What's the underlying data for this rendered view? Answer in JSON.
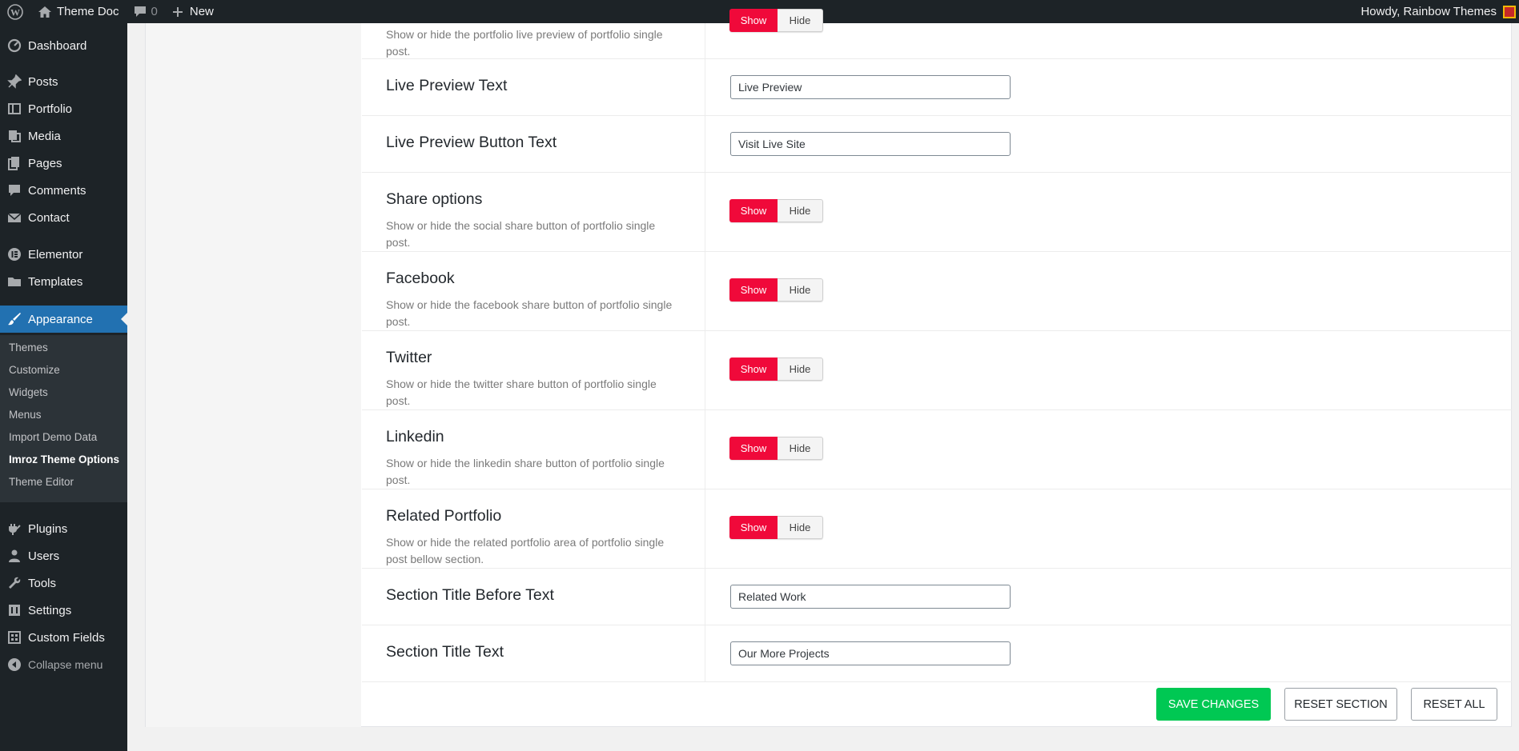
{
  "adminbar": {
    "site_name": "Theme Doc",
    "comments_count": "0",
    "new_label": "New",
    "greeting": "Howdy, Rainbow Themes"
  },
  "sidebar": {
    "items": [
      {
        "label": "Dashboard",
        "icon": "dashboard-icon"
      },
      {
        "label": "Posts",
        "icon": "pin-icon"
      },
      {
        "label": "Portfolio",
        "icon": "portfolio-icon"
      },
      {
        "label": "Media",
        "icon": "media-icon"
      },
      {
        "label": "Pages",
        "icon": "pages-icon"
      },
      {
        "label": "Comments",
        "icon": "comment-icon"
      },
      {
        "label": "Contact",
        "icon": "mail-icon"
      },
      {
        "label": "Elementor",
        "icon": "elementor-icon"
      },
      {
        "label": "Templates",
        "icon": "folder-icon"
      },
      {
        "label": "Appearance",
        "icon": "brush-icon"
      },
      {
        "label": "Plugins",
        "icon": "plug-icon"
      },
      {
        "label": "Users",
        "icon": "user-icon"
      },
      {
        "label": "Tools",
        "icon": "wrench-icon"
      },
      {
        "label": "Settings",
        "icon": "settings-icon"
      },
      {
        "label": "Custom Fields",
        "icon": "grid-icon"
      }
    ],
    "submenu": [
      "Themes",
      "Customize",
      "Widgets",
      "Menus",
      "Import Demo Data",
      "Imroz Theme Options",
      "Theme Editor"
    ],
    "collapse_label": "Collapse menu"
  },
  "fields": [
    {
      "desc": "Show or hide the portfolio live preview of portfolio single post."
    },
    {
      "title": "Live Preview Text",
      "value": "Live Preview"
    },
    {
      "title": "Live Preview Button Text",
      "value": "Visit Live Site"
    },
    {
      "title": "Share options",
      "desc": "Show or hide the social share button of portfolio single post."
    },
    {
      "title": "Facebook",
      "desc": "Show or hide the facebook share button of portfolio single post."
    },
    {
      "title": "Twitter",
      "desc": "Show or hide the twitter share button of portfolio single post."
    },
    {
      "title": "Linkedin",
      "desc": "Show or hide the linkedin share button of portfolio single post."
    },
    {
      "title": "Related Portfolio",
      "desc": "Show or hide the related portfolio area of portfolio single post bellow section."
    },
    {
      "title": "Section Title Before Text",
      "value": "Related Work"
    },
    {
      "title": "Section Title Text",
      "value": "Our More Projects"
    }
  ],
  "toggle": {
    "show_label": "Show",
    "hide_label": "Hide"
  },
  "buttons": {
    "save": "Save Changes",
    "reset_section": "Reset Section",
    "reset_all": "Reset All"
  },
  "colors": {
    "accent": "#f0093a",
    "save": "#00c853",
    "admin_blue": "#2271b1"
  }
}
